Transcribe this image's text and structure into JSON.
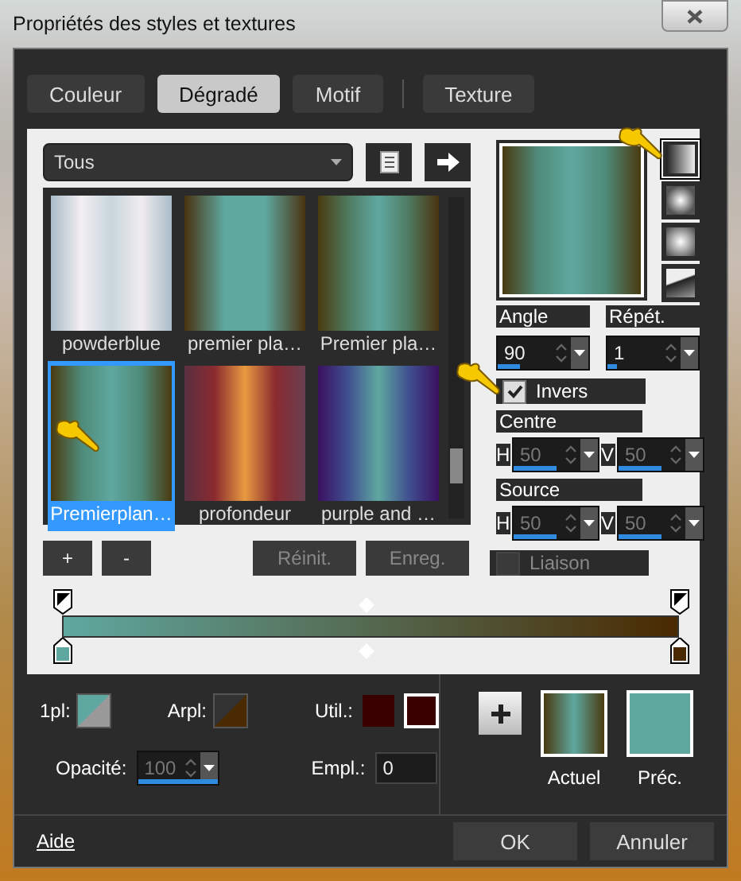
{
  "window": {
    "title": "Propriétés des styles et textures"
  },
  "tabs": [
    {
      "label": "Couleur",
      "selected": false
    },
    {
      "label": "Dégradé",
      "selected": true
    },
    {
      "label": "Motif",
      "selected": false
    },
    {
      "label": "Texture",
      "selected": false
    }
  ],
  "category": {
    "value": "Tous"
  },
  "gallery": [
    {
      "name": "powderblue",
      "selected": false
    },
    {
      "name": "premier pla…",
      "selected": false
    },
    {
      "name": "Premier pla…",
      "selected": false
    },
    {
      "name": "Premierplan…",
      "selected": true
    },
    {
      "name": "profondeur",
      "selected": false
    },
    {
      "name": "purple and …",
      "selected": false
    }
  ],
  "gallery_buttons": [
    {
      "label": "+",
      "disabled": false
    },
    {
      "label": "-",
      "disabled": false
    },
    {
      "label": "Réinit.",
      "disabled": true
    },
    {
      "label": "Enreg.",
      "disabled": true
    }
  ],
  "style_types": [
    {
      "kind": "linear",
      "selected": true
    },
    {
      "kind": "rectangular",
      "selected": false
    },
    {
      "kind": "radial",
      "selected": false
    },
    {
      "kind": "sunburst",
      "selected": false
    }
  ],
  "angle": {
    "label": "Angle",
    "value": "90",
    "level": 0.25
  },
  "repeat": {
    "label": "Répét.",
    "value": "1",
    "level": 0.1
  },
  "invert": {
    "label": "Invers",
    "checked": true
  },
  "centre": {
    "label": "Centre",
    "disabled": true,
    "h": {
      "label": "H",
      "value": "50",
      "level": 0.5
    },
    "v": {
      "label": "V",
      "value": "50",
      "level": 0.5
    }
  },
  "source": {
    "label": "Source",
    "disabled": true,
    "h": {
      "label": "H",
      "value": "50",
      "level": 0.5
    },
    "v": {
      "label": "V",
      "value": "50",
      "level": 0.5
    }
  },
  "link": {
    "label": "Liaison",
    "checked": false,
    "disabled": true
  },
  "gradient_editor": {
    "stops": [
      {
        "color": "#5fa8a0"
      },
      {
        "color": "#4a2a00"
      }
    ]
  },
  "foreground": {
    "label": "1pl:",
    "color": "#5fa8a0"
  },
  "background": {
    "label": "Arpl:",
    "color": "#4a2a00"
  },
  "user": {
    "label": "Util.:",
    "swatches": [
      {
        "color": "#3a0000",
        "selected": false
      },
      {
        "color": "#3a0000",
        "selected": true
      }
    ]
  },
  "opacity": {
    "label": "Opacité:",
    "value": "100",
    "level": 1,
    "disabled": true
  },
  "location": {
    "label": "Empl.:",
    "value": "0"
  },
  "current": {
    "label": "Actuel"
  },
  "previous": {
    "label": "Préc.",
    "color": "#5fa8a0"
  },
  "footer": {
    "help": "Aide",
    "ok": "OK",
    "cancel": "Annuler"
  }
}
